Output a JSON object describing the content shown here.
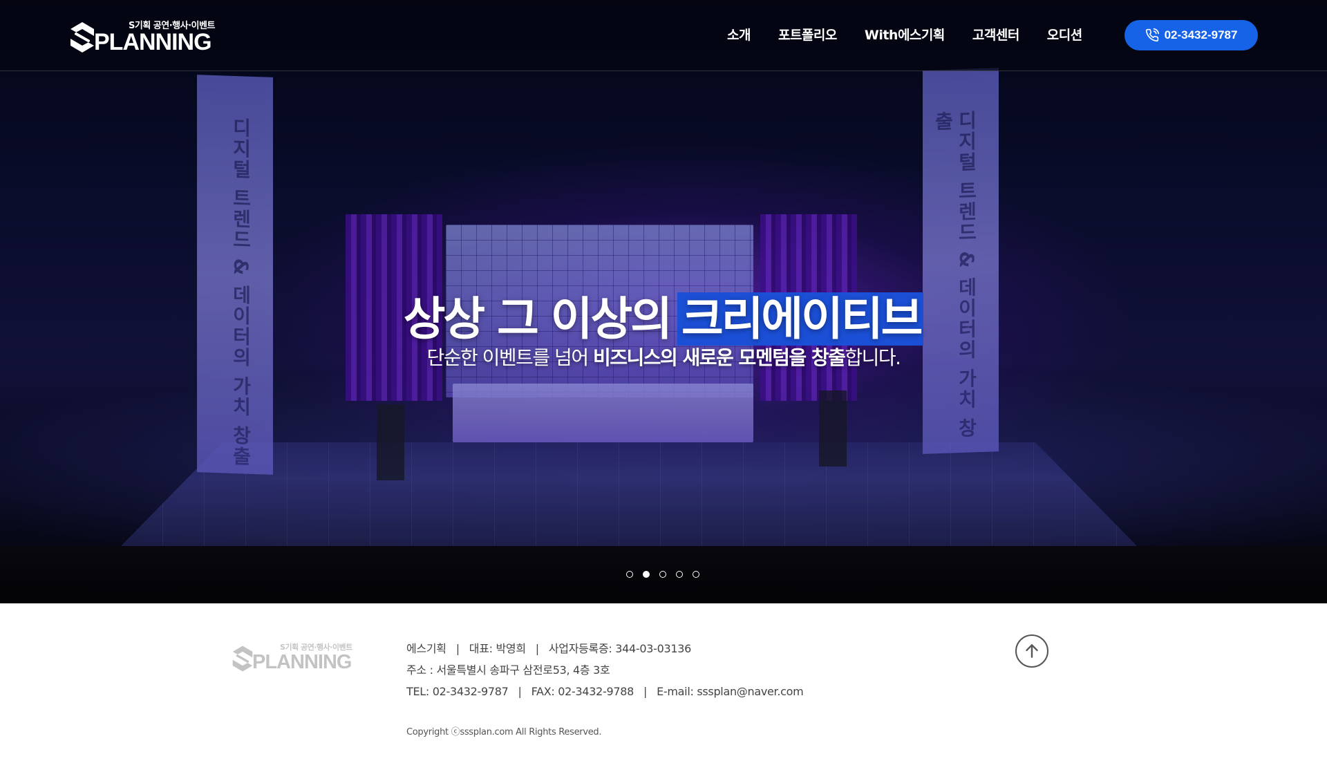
{
  "header": {
    "logo_sub": "S기획 공연·행사·이벤트",
    "logo_word": "PLANNING",
    "nav": [
      {
        "label": "소개"
      },
      {
        "label": "포트폴리오"
      },
      {
        "label": "With에스기획"
      },
      {
        "label": "고객센터"
      },
      {
        "label": "오디션"
      }
    ],
    "phone": "02-3432-9787"
  },
  "hero": {
    "title_pre": "상상 그 이상의",
    "title_highlight": "크리에이티브",
    "sub_pre": "단순한 이벤트를 넘어 ",
    "sub_bold": "비즈니스의 새로운 모멘텀을 창출",
    "sub_post": "합니다.",
    "banner_text": "디지털 트렌드 & 데이터의 가치 창출",
    "slides_count": 5,
    "active_slide_index": 1
  },
  "footer": {
    "logo_sub": "S기획 공연·행사·이벤트",
    "logo_word": "PLANNING",
    "company": "에스기획",
    "ceo": "대표: 박영희",
    "biz_no": "사업자등록증: 344-03-03136",
    "address": "주소 : 서울특별시 송파구 삼전로53, 4층 3호",
    "tel": "TEL: 02-3432-9787",
    "fax": "FAX: 02-3432-9788",
    "email": "E-mail: sssplan@naver.com",
    "copyright": "Copyright ⓒsssplan.com  All Rights Reserved."
  },
  "colors": {
    "accent": "#1763e8",
    "highlight": "#1b4fd6",
    "footer_text": "#444444"
  },
  "icons": {
    "phone": "phone-icon",
    "top": "arrow-up-circle-icon"
  }
}
